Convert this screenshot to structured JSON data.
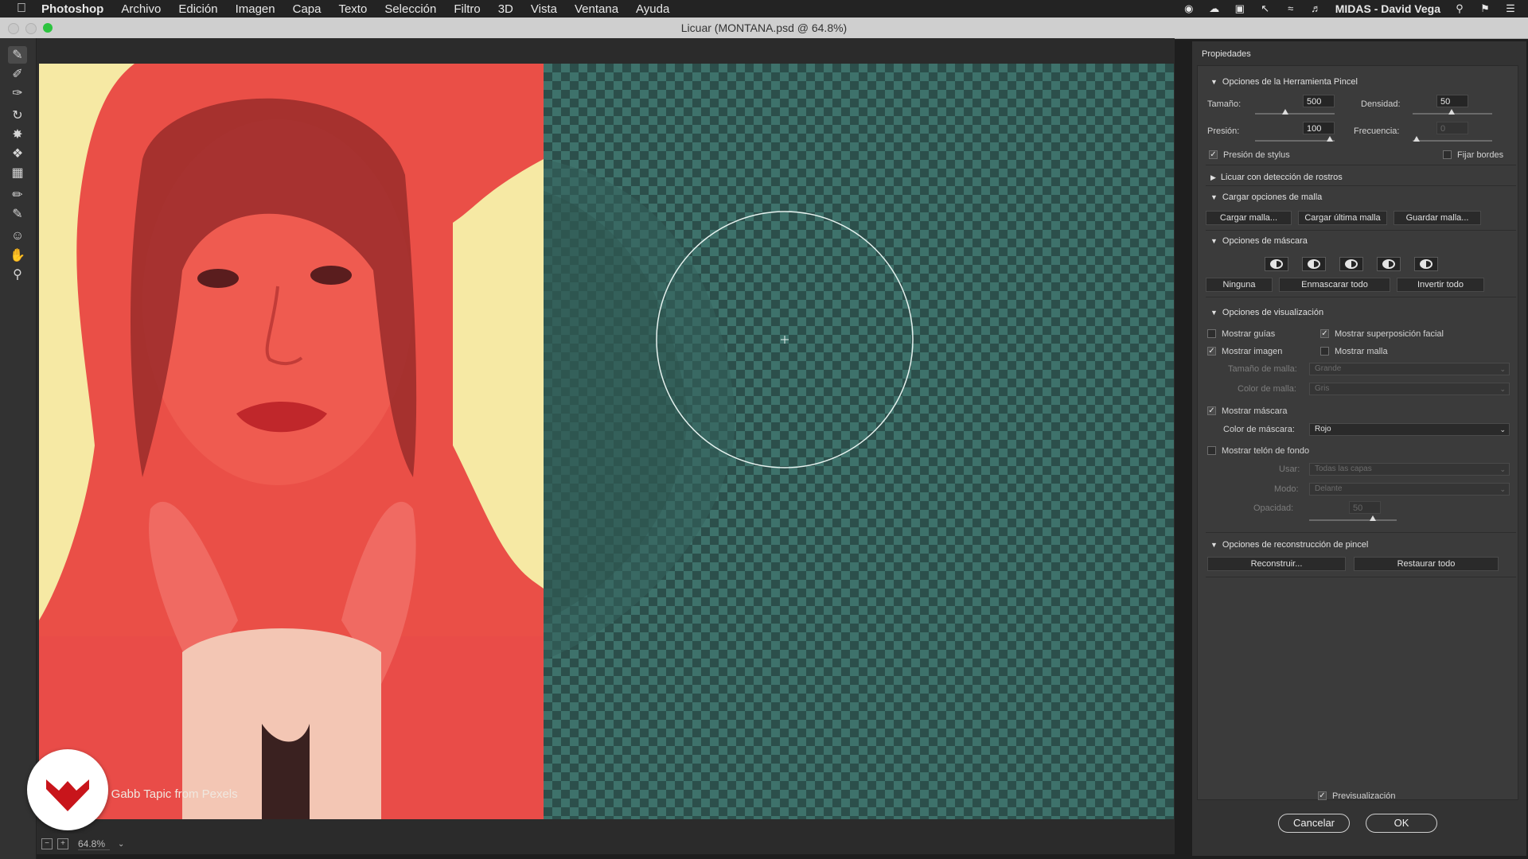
{
  "menubar": {
    "app": "Photoshop",
    "items": [
      "Archivo",
      "Edición",
      "Imagen",
      "Capa",
      "Texto",
      "Selección",
      "Filtro",
      "3D",
      "Vista",
      "Ventana",
      "Ayuda"
    ],
    "user": "MIDAS - David Vega"
  },
  "window": {
    "title": "Licuar (MONTANA.psd @ 64.8%)"
  },
  "toolbar": {
    "tools": [
      "forward-warp",
      "reconstruct",
      "smooth",
      "twirl",
      "pucker",
      "bloat",
      "push-left",
      "freeze-mask",
      "thaw-mask",
      "face",
      "hand",
      "zoom"
    ]
  },
  "canvas": {
    "photo_credit": "y Gabb Tapic from Pexels",
    "mask_color": "#e8413f",
    "checker_color": "#3e726b"
  },
  "status": {
    "zoom": "64.8%"
  },
  "panel": {
    "title": "Propiedades",
    "brush": {
      "header": "Opciones de la Herramienta Pincel",
      "size_label": "Tamaño:",
      "size": "500",
      "density_label": "Densidad:",
      "density": "50",
      "pressure_label": "Presión:",
      "pressure": "100",
      "rate_label": "Frecuencia:",
      "rate": "0",
      "stylus_label": "Presión de stylus",
      "pin_edges_label": "Fijar bordes"
    },
    "face": {
      "header": "Licuar con detección de rostros"
    },
    "mesh": {
      "header": "Cargar opciones de malla",
      "load": "Cargar malla...",
      "load_last": "Cargar última malla",
      "save": "Guardar malla..."
    },
    "mask": {
      "header": "Opciones de máscara",
      "none": "Ninguna",
      "mask_all": "Enmascarar todo",
      "invert_all": "Invertir todo"
    },
    "view": {
      "header": "Opciones de visualización",
      "show_guides": "Mostrar guías",
      "show_face_overlay": "Mostrar superposición facial",
      "show_image": "Mostrar imagen",
      "show_mesh": "Mostrar malla",
      "mesh_size_label": "Tamaño de malla:",
      "mesh_size": "Grande",
      "mesh_color_label": "Color de malla:",
      "mesh_color": "Gris",
      "show_mask": "Mostrar máscara",
      "mask_color_label": "Color de máscara:",
      "mask_color": "Rojo",
      "show_backdrop": "Mostrar telón de fondo",
      "use_label": "Usar:",
      "use": "Todas las capas",
      "mode_label": "Modo:",
      "mode": "Delante",
      "opacity_label": "Opacidad:",
      "opacity": "50"
    },
    "reconstruct": {
      "header": "Opciones de reconstrucción de pincel",
      "reconstruct": "Reconstruir...",
      "restore_all": "Restaurar todo"
    },
    "preview_label": "Previsualización",
    "cancel": "Cancelar",
    "ok": "OK"
  }
}
